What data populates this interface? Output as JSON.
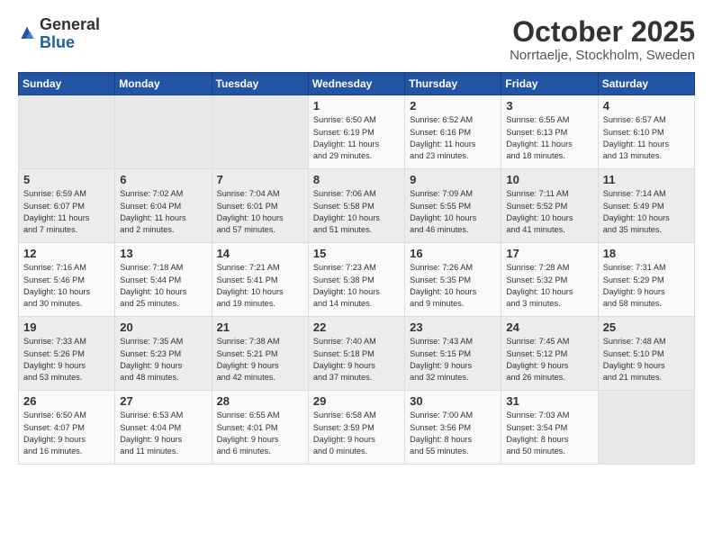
{
  "logo": {
    "general": "General",
    "blue": "Blue"
  },
  "title": "October 2025",
  "location": "Norrtaelje, Stockholm, Sweden",
  "headers": [
    "Sunday",
    "Monday",
    "Tuesday",
    "Wednesday",
    "Thursday",
    "Friday",
    "Saturday"
  ],
  "weeks": [
    [
      {
        "day": "",
        "info": ""
      },
      {
        "day": "",
        "info": ""
      },
      {
        "day": "",
        "info": ""
      },
      {
        "day": "1",
        "info": "Sunrise: 6:50 AM\nSunset: 6:19 PM\nDaylight: 11 hours\nand 29 minutes."
      },
      {
        "day": "2",
        "info": "Sunrise: 6:52 AM\nSunset: 6:16 PM\nDaylight: 11 hours\nand 23 minutes."
      },
      {
        "day": "3",
        "info": "Sunrise: 6:55 AM\nSunset: 6:13 PM\nDaylight: 11 hours\nand 18 minutes."
      },
      {
        "day": "4",
        "info": "Sunrise: 6:57 AM\nSunset: 6:10 PM\nDaylight: 11 hours\nand 13 minutes."
      }
    ],
    [
      {
        "day": "5",
        "info": "Sunrise: 6:59 AM\nSunset: 6:07 PM\nDaylight: 11 hours\nand 7 minutes."
      },
      {
        "day": "6",
        "info": "Sunrise: 7:02 AM\nSunset: 6:04 PM\nDaylight: 11 hours\nand 2 minutes."
      },
      {
        "day": "7",
        "info": "Sunrise: 7:04 AM\nSunset: 6:01 PM\nDaylight: 10 hours\nand 57 minutes."
      },
      {
        "day": "8",
        "info": "Sunrise: 7:06 AM\nSunset: 5:58 PM\nDaylight: 10 hours\nand 51 minutes."
      },
      {
        "day": "9",
        "info": "Sunrise: 7:09 AM\nSunset: 5:55 PM\nDaylight: 10 hours\nand 46 minutes."
      },
      {
        "day": "10",
        "info": "Sunrise: 7:11 AM\nSunset: 5:52 PM\nDaylight: 10 hours\nand 41 minutes."
      },
      {
        "day": "11",
        "info": "Sunrise: 7:14 AM\nSunset: 5:49 PM\nDaylight: 10 hours\nand 35 minutes."
      }
    ],
    [
      {
        "day": "12",
        "info": "Sunrise: 7:16 AM\nSunset: 5:46 PM\nDaylight: 10 hours\nand 30 minutes."
      },
      {
        "day": "13",
        "info": "Sunrise: 7:18 AM\nSunset: 5:44 PM\nDaylight: 10 hours\nand 25 minutes."
      },
      {
        "day": "14",
        "info": "Sunrise: 7:21 AM\nSunset: 5:41 PM\nDaylight: 10 hours\nand 19 minutes."
      },
      {
        "day": "15",
        "info": "Sunrise: 7:23 AM\nSunset: 5:38 PM\nDaylight: 10 hours\nand 14 minutes."
      },
      {
        "day": "16",
        "info": "Sunrise: 7:26 AM\nSunset: 5:35 PM\nDaylight: 10 hours\nand 9 minutes."
      },
      {
        "day": "17",
        "info": "Sunrise: 7:28 AM\nSunset: 5:32 PM\nDaylight: 10 hours\nand 3 minutes."
      },
      {
        "day": "18",
        "info": "Sunrise: 7:31 AM\nSunset: 5:29 PM\nDaylight: 9 hours\nand 58 minutes."
      }
    ],
    [
      {
        "day": "19",
        "info": "Sunrise: 7:33 AM\nSunset: 5:26 PM\nDaylight: 9 hours\nand 53 minutes."
      },
      {
        "day": "20",
        "info": "Sunrise: 7:35 AM\nSunset: 5:23 PM\nDaylight: 9 hours\nand 48 minutes."
      },
      {
        "day": "21",
        "info": "Sunrise: 7:38 AM\nSunset: 5:21 PM\nDaylight: 9 hours\nand 42 minutes."
      },
      {
        "day": "22",
        "info": "Sunrise: 7:40 AM\nSunset: 5:18 PM\nDaylight: 9 hours\nand 37 minutes."
      },
      {
        "day": "23",
        "info": "Sunrise: 7:43 AM\nSunset: 5:15 PM\nDaylight: 9 hours\nand 32 minutes."
      },
      {
        "day": "24",
        "info": "Sunrise: 7:45 AM\nSunset: 5:12 PM\nDaylight: 9 hours\nand 26 minutes."
      },
      {
        "day": "25",
        "info": "Sunrise: 7:48 AM\nSunset: 5:10 PM\nDaylight: 9 hours\nand 21 minutes."
      }
    ],
    [
      {
        "day": "26",
        "info": "Sunrise: 6:50 AM\nSunset: 4:07 PM\nDaylight: 9 hours\nand 16 minutes."
      },
      {
        "day": "27",
        "info": "Sunrise: 6:53 AM\nSunset: 4:04 PM\nDaylight: 9 hours\nand 11 minutes."
      },
      {
        "day": "28",
        "info": "Sunrise: 6:55 AM\nSunset: 4:01 PM\nDaylight: 9 hours\nand 6 minutes."
      },
      {
        "day": "29",
        "info": "Sunrise: 6:58 AM\nSunset: 3:59 PM\nDaylight: 9 hours\nand 0 minutes."
      },
      {
        "day": "30",
        "info": "Sunrise: 7:00 AM\nSunset: 3:56 PM\nDaylight: 8 hours\nand 55 minutes."
      },
      {
        "day": "31",
        "info": "Sunrise: 7:03 AM\nSunset: 3:54 PM\nDaylight: 8 hours\nand 50 minutes."
      },
      {
        "day": "",
        "info": ""
      }
    ]
  ]
}
